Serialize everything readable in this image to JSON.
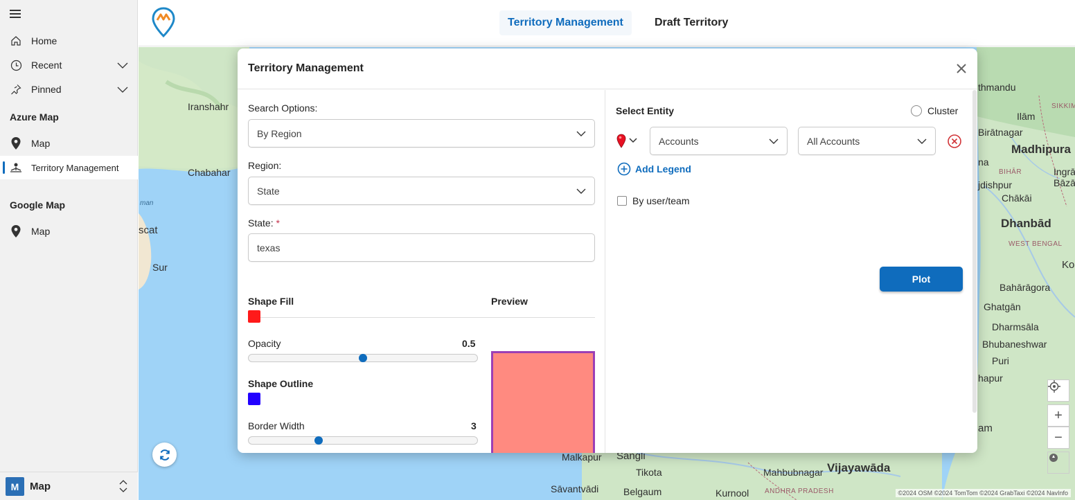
{
  "sidebar": {
    "items": [
      {
        "label": "Home"
      },
      {
        "label": "Recent"
      },
      {
        "label": "Pinned"
      }
    ],
    "sections": [
      {
        "title": "Azure Map",
        "items": [
          {
            "label": "Map"
          },
          {
            "label": "Territory Management"
          }
        ]
      },
      {
        "title": "Google Map",
        "items": [
          {
            "label": "Map"
          }
        ]
      }
    ],
    "footer": {
      "badge": "M",
      "app_name": "Map"
    }
  },
  "header": {
    "tabs": [
      {
        "label": "Territory Management",
        "active": true
      },
      {
        "label": "Draft Territory",
        "active": false
      }
    ]
  },
  "map": {
    "labels": {
      "iranshahr": "Iranshahr",
      "chabahar": "Chabahar",
      "oman": "man",
      "muscat": "scat",
      "sur": "Sur",
      "kathmandu": "thmandu",
      "sikkim": "SIKKIM",
      "ilam": "Ilām",
      "biratnagar": "Birātnagar",
      "madhipura": "Madhipura",
      "na": "na",
      "bihar": "BIHĀR",
      "ingraj": "Ingrāj",
      "bazar": "Bāzā",
      "jdishpur": "jdishpur",
      "chakai": "Chākāi",
      "dhanbad": "Dhanbād",
      "westbengal": "WEST BENGAL",
      "ko": "Ko",
      "baharagora": "Bahārāgora",
      "ghatgan": "Ghatgān",
      "dharmsala": "Dharmsāla",
      "bhubaneshwar": "Bhubaneshwar",
      "puri": "Puri",
      "hapur": "hapur",
      "am": "am",
      "malkapur": "Malkapur",
      "sangli": "Sāngli",
      "belgaum": "Belgaum",
      "savantvadi": "Sāvantvādi",
      "tikota": "Tikota",
      "mahbubnagar": "Mahbubnagar",
      "kurnool": "Kurnool",
      "andhra": "ANDHRA PRADESH",
      "vijayawada": "Vijayawāda"
    },
    "attribution": "©2024 OSM ©2024 TomTom ©2024 GrabTaxi ©2024 NavInfo",
    "colors": {
      "water": "#9fd3f7",
      "land": "#cfe6c6",
      "land_dark": "#aad3a4"
    }
  },
  "dialog": {
    "title": "Territory Management",
    "left": {
      "search_options_label": "Search Options:",
      "search_options_value": "By Region",
      "region_label": "Region:",
      "region_value": "State",
      "state_label": "State:",
      "state_required": "*",
      "state_value": "texas",
      "shape_fill_label": "Shape Fill",
      "shape_fill_color": "#ff1a1a",
      "opacity_label": "Opacity",
      "opacity_value": "0.5",
      "opacity_fraction": 0.5,
      "shape_outline_label": "Shape Outline",
      "shape_outline_color": "#2200ff",
      "border_width_label": "Border Width",
      "border_width_value": "3",
      "preview_label": "Preview"
    },
    "right": {
      "select_entity_label": "Select Entity",
      "cluster_label": "Cluster",
      "entity_value": "Accounts",
      "view_value": "All Accounts",
      "add_legend_label": "Add Legend",
      "by_user_team_label": "By user/team",
      "plot_label": "Plot"
    }
  }
}
